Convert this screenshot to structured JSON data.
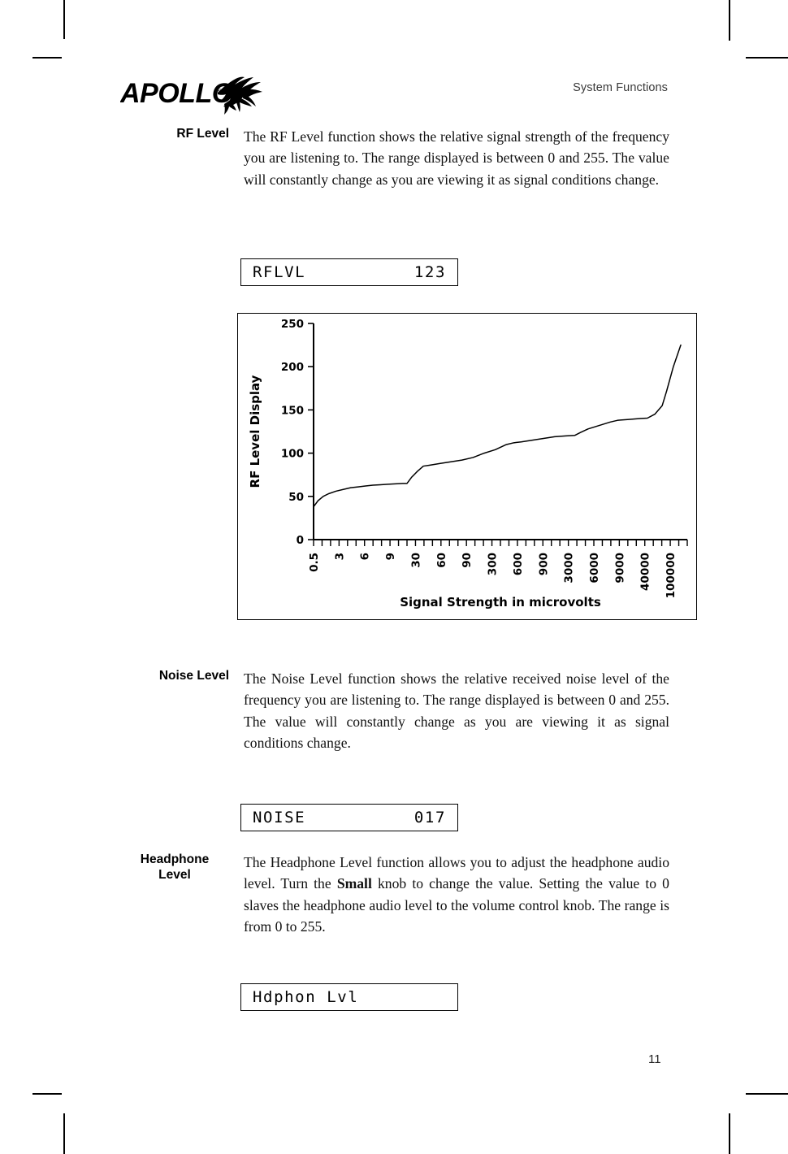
{
  "header": {
    "title": "System Functions",
    "logo_text": "APOLLO",
    "logo_icon": "pegasus-logo"
  },
  "sections": [
    {
      "label": "RF Level",
      "label_lines": [
        "RF Level"
      ],
      "body_pre": "The RF Level function shows the relative signal strength of the frequency you are listening to. The range displayed is between 0 and 255. The value will constantly change as you are viewing it as signal conditions change.",
      "body_bold": "",
      "body_post": "",
      "lcd": {
        "left": "RFLVL",
        "right": "123"
      }
    },
    {
      "label": "Noise Level",
      "label_lines": [
        "Noise Level"
      ],
      "body_pre": "The Noise Level function shows the relative received noise level of the frequency you are listening to. The range displayed is between 0 and 255. The value will constantly change as you are viewing it as signal conditions change.",
      "body_bold": "",
      "body_post": "",
      "lcd": {
        "left": "NOISE",
        "right": "017"
      }
    },
    {
      "label": "Headphone Level",
      "label_lines": [
        "Headphone",
        "Level"
      ],
      "body_pre": "The Headphone Level function allows you to adjust the headphone audio level. Turn the ",
      "body_bold": "Small",
      "body_post": " knob to change the value. Setting the value to 0 slaves the headphone audio level to the volume control knob. The range is from 0 to 255.",
      "lcd": {
        "left": "Hdphon Lvl",
        "right": ""
      }
    }
  ],
  "page_number": "11",
  "chart_data": {
    "type": "line",
    "title": "",
    "xlabel": "Signal Strength in microvolts",
    "ylabel": "RF Level Display",
    "ylim": [
      0,
      250
    ],
    "yticks": [
      0,
      50,
      100,
      150,
      200,
      250
    ],
    "grid": false,
    "legend": "none",
    "xtick_labels": [
      "0.5",
      "3",
      "6",
      "9",
      "30",
      "60",
      "90",
      "300",
      "600",
      "900",
      "3000",
      "6000",
      "9000",
      "40000",
      "100000"
    ],
    "x": [
      "0.5",
      "3",
      "6",
      "9",
      "30",
      "60",
      "90",
      "300",
      "600",
      "900",
      "3000",
      "6000",
      "9000",
      "40000",
      "100000"
    ],
    "values": [
      38,
      53,
      60,
      63,
      65,
      85,
      90,
      100,
      112,
      120,
      124,
      138,
      140,
      172,
      225
    ],
    "series": [
      {
        "name": "RF Level Display",
        "values": [
          38,
          53,
          60,
          63,
          65,
          85,
          90,
          100,
          112,
          120,
          124,
          138,
          140,
          172,
          225
        ]
      }
    ],
    "detail_points": [
      [
        0,
        38
      ],
      [
        0.6,
        45
      ],
      [
        1.3,
        50
      ],
      [
        2.0,
        53
      ],
      [
        3.0,
        56
      ],
      [
        4.0,
        58
      ],
      [
        5.0,
        60
      ],
      [
        6.0,
        61
      ],
      [
        7.0,
        62
      ],
      [
        8.0,
        63
      ],
      [
        9.0,
        63.5
      ],
      [
        10.0,
        64
      ],
      [
        11.0,
        64.5
      ],
      [
        12.0,
        65
      ],
      [
        12.6,
        65
      ],
      [
        13.2,
        72
      ],
      [
        14.0,
        79
      ],
      [
        14.8,
        85
      ],
      [
        15.6,
        86
      ],
      [
        17.0,
        88
      ],
      [
        18.5,
        90
      ],
      [
        20.0,
        92
      ],
      [
        21.5,
        95
      ],
      [
        23.0,
        100
      ],
      [
        24.5,
        104
      ],
      [
        26.0,
        110
      ],
      [
        27.0,
        112
      ],
      [
        28.0,
        113
      ],
      [
        29.5,
        115
      ],
      [
        31.0,
        117
      ],
      [
        32.5,
        119
      ],
      [
        34.0,
        120
      ],
      [
        35.2,
        120.5
      ],
      [
        36.0,
        124
      ],
      [
        37.0,
        128
      ],
      [
        38.5,
        132
      ],
      [
        40.0,
        136
      ],
      [
        41.0,
        138
      ],
      [
        42.5,
        139
      ],
      [
        44.0,
        140
      ],
      [
        45.0,
        140.5
      ],
      [
        46.0,
        145
      ],
      [
        47.0,
        155
      ],
      [
        47.6,
        172
      ],
      [
        48.5,
        200
      ],
      [
        49.5,
        225
      ]
    ]
  }
}
